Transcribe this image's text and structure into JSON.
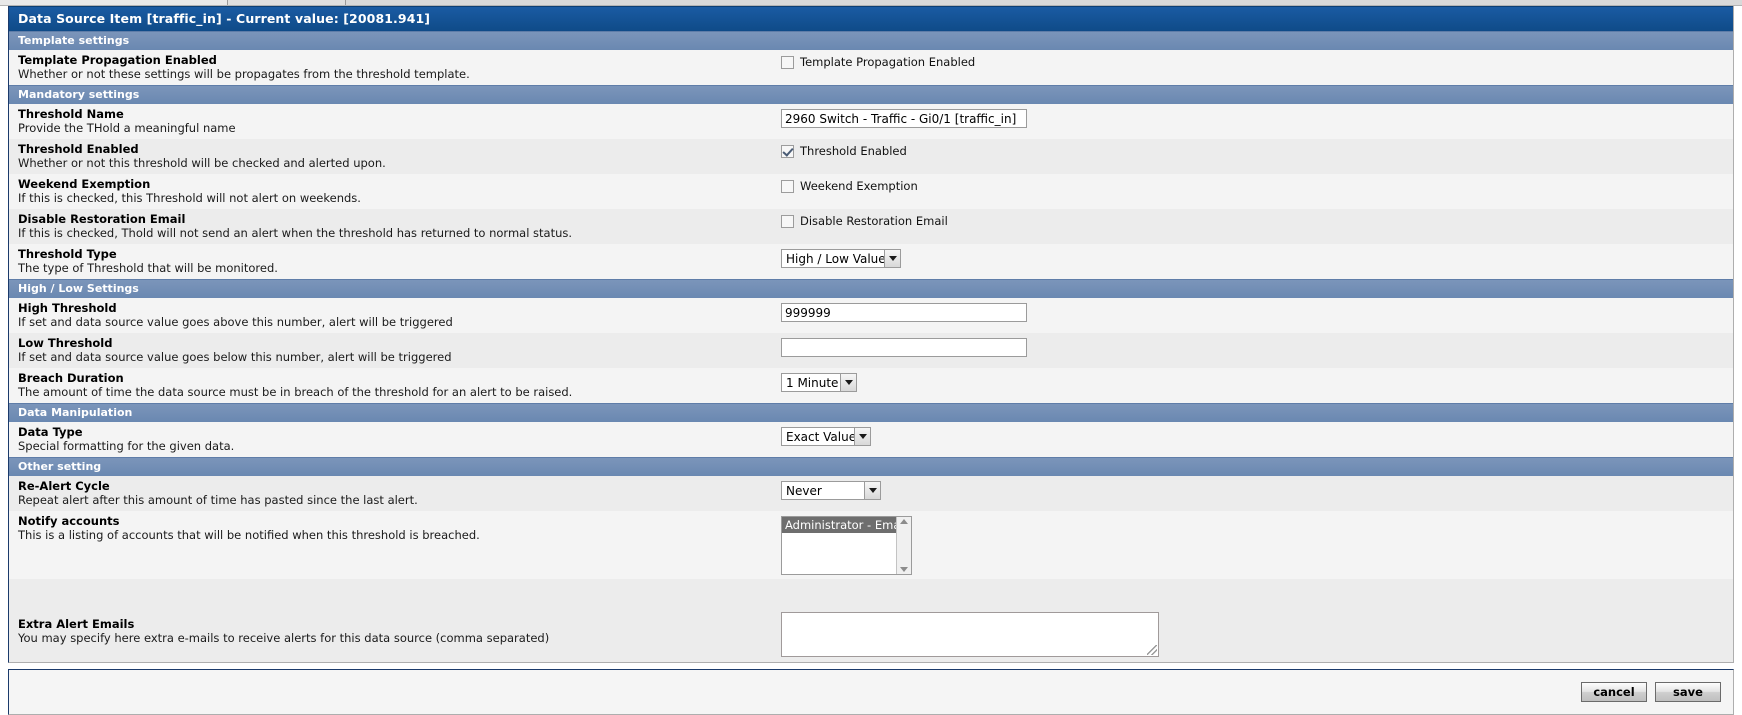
{
  "window": {
    "title_prefix": "Data Source Item",
    "title_source": "[traffic_in]",
    "title_sep": "-",
    "title_value_label": "Current value:",
    "title_value": "[20081.941]",
    "title_full": "Data Source Item [traffic_in] - Current value: [20081.941]"
  },
  "colors": {
    "title_bar": "#11508f",
    "section_header": "#6f8cb4",
    "row_shade_a": "#ececec",
    "row_shade_b": "#f4f4f4",
    "selected_item": "#6e6e6e"
  },
  "sections": {
    "template_settings": {
      "label": "Template settings"
    },
    "mandatory_settings": {
      "label": "Mandatory settings"
    },
    "high_low_settings": {
      "label": "High / Low Settings"
    },
    "data_manipulation": {
      "label": "Data Manipulation"
    },
    "other_setting": {
      "label": "Other setting"
    }
  },
  "fields": {
    "template_propagation": {
      "label": "Template Propagation Enabled",
      "description": "Whether or not these settings will be propagates from the threshold template.",
      "checkbox_label": "Template Propagation Enabled",
      "checked": false
    },
    "threshold_name": {
      "label": "Threshold Name",
      "description": "Provide the THold a meaningful name",
      "value": "2960 Switch - Traffic - Gi0/1 [traffic_in]",
      "placeholder": ""
    },
    "threshold_enabled": {
      "label": "Threshold Enabled",
      "description": "Whether or not this threshold will be checked and alerted upon.",
      "checkbox_label": "Threshold Enabled",
      "checked": true
    },
    "weekend_exemption": {
      "label": "Weekend Exemption",
      "description": "If this is checked, this Threshold will not alert on weekends.",
      "checkbox_label": "Weekend Exemption",
      "checked": false
    },
    "disable_restoration_email": {
      "label": "Disable Restoration Email",
      "description": "If this is checked, Thold will not send an alert when the threshold has returned to normal status.",
      "checkbox_label": "Disable Restoration Email",
      "checked": false
    },
    "threshold_type": {
      "label": "Threshold Type",
      "description": "The type of Threshold that will be monitored.",
      "selected": "High / Low Values"
    },
    "high_threshold": {
      "label": "High Threshold",
      "description": "If set and data source value goes above this number, alert will be triggered",
      "value": "999999",
      "placeholder": ""
    },
    "low_threshold": {
      "label": "Low Threshold",
      "description": "If set and data source value goes below this number, alert will be triggered",
      "value": "",
      "placeholder": ""
    },
    "breach_duration": {
      "label": "Breach Duration",
      "description": "The amount of time the data source must be in breach of the threshold for an alert to be raised.",
      "selected": "1 Minute"
    },
    "data_type": {
      "label": "Data Type",
      "description": "Special formatting for the given data.",
      "selected": "Exact Value"
    },
    "re_alert_cycle": {
      "label": "Re-Alert Cycle",
      "description": "Repeat alert after this amount of time has pasted since the last alert.",
      "selected": "Never"
    },
    "notify_accounts": {
      "label": "Notify accounts",
      "description": "This is a listing of accounts that will be notified when this threshold is breached.",
      "options": [
        "Administrator - Email"
      ],
      "selected": "Administrator - Email"
    },
    "extra_alert_emails": {
      "label": "Extra Alert Emails",
      "description": "You may specify here extra e-mails to receive alerts for this data source (comma separated)",
      "value": "",
      "placeholder": ""
    }
  },
  "footer": {
    "cancel_label": "cancel",
    "save_label": "save"
  }
}
